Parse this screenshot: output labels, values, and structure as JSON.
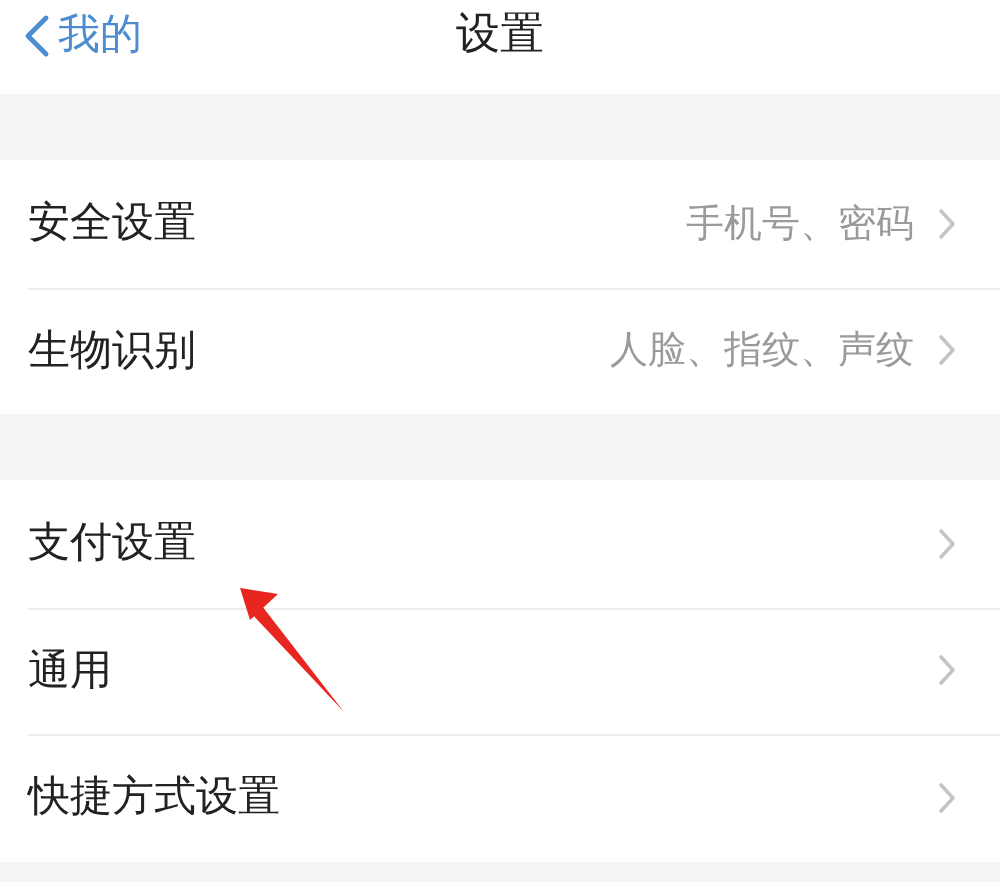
{
  "nav": {
    "back_label": "我的",
    "title": "设置"
  },
  "groups": [
    {
      "items": [
        {
          "label": "安全设置",
          "detail": "手机号、密码"
        },
        {
          "label": "生物识别",
          "detail": "人脸、指纹、声纹"
        }
      ]
    },
    {
      "items": [
        {
          "label": "支付设置"
        },
        {
          "label": "通用"
        },
        {
          "label": "快捷方式设置"
        }
      ]
    }
  ],
  "annotation": {
    "kind": "arrow"
  }
}
